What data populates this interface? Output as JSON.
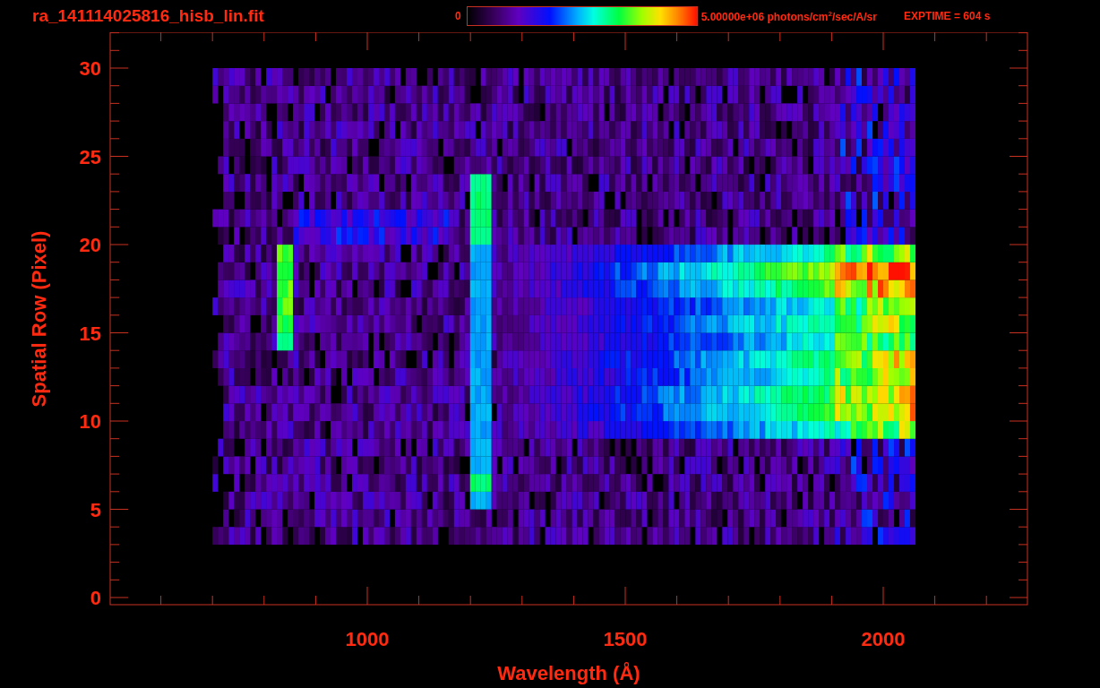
{
  "header": {
    "title": "ra_141114025816_hisb_lin.fit",
    "colorbar": {
      "min_label": "0",
      "max_label": "5.00000e+06 photons/cm$^{2}$/sec/A/sr"
    },
    "exptime": "EXPTIME = 604 s"
  },
  "plot": {
    "xlabel": "Wavelength (Å)",
    "ylabel": "Spatial Row (Pixel)",
    "xticks": [
      "1000",
      "1500",
      "2000"
    ],
    "yticks": [
      "30",
      "25",
      "20",
      "15",
      "10",
      "5",
      "0"
    ]
  }
}
